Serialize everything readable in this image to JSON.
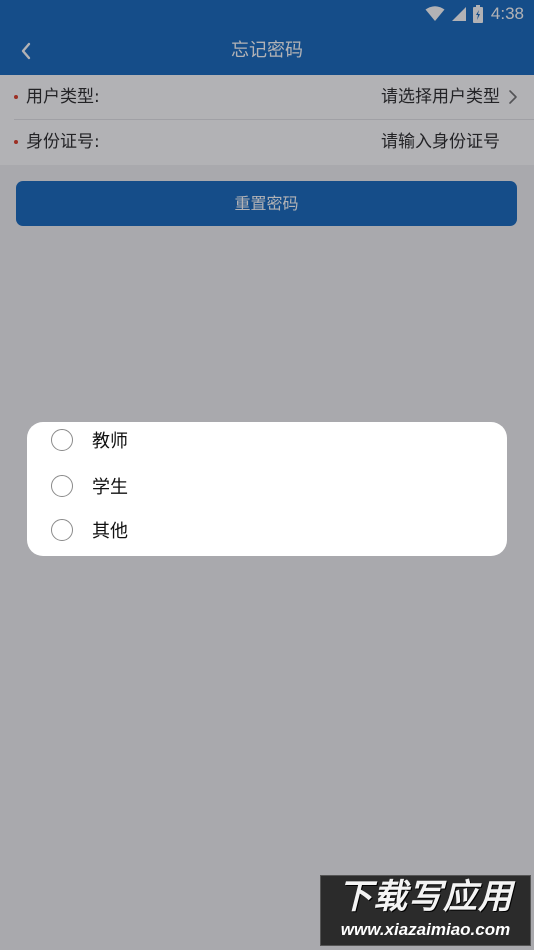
{
  "status_bar": {
    "time": "4:38",
    "icons": [
      "wifi-icon",
      "signal-icon",
      "battery-icon"
    ]
  },
  "app_bar": {
    "title": "忘记密码",
    "back_icon": "chevron-left-icon"
  },
  "form": {
    "user_type": {
      "label": "用户类型:",
      "value": "请选择用户类型"
    },
    "id_number": {
      "label": "身份证号:",
      "placeholder": "请输入身份证号"
    }
  },
  "reset_button": {
    "label": "重置密码"
  },
  "dialog": {
    "options": [
      {
        "label": "教师",
        "selected": false
      },
      {
        "label": "学生",
        "selected": false
      },
      {
        "label": "其他",
        "selected": false
      }
    ]
  },
  "watermark": {
    "title": "下载写应用",
    "url": "www.xiazaimiao.com"
  },
  "colors": {
    "primary": "#1f6fc0",
    "required": "#e0442e",
    "overlay": "rgba(0,0,10,0.30)"
  }
}
